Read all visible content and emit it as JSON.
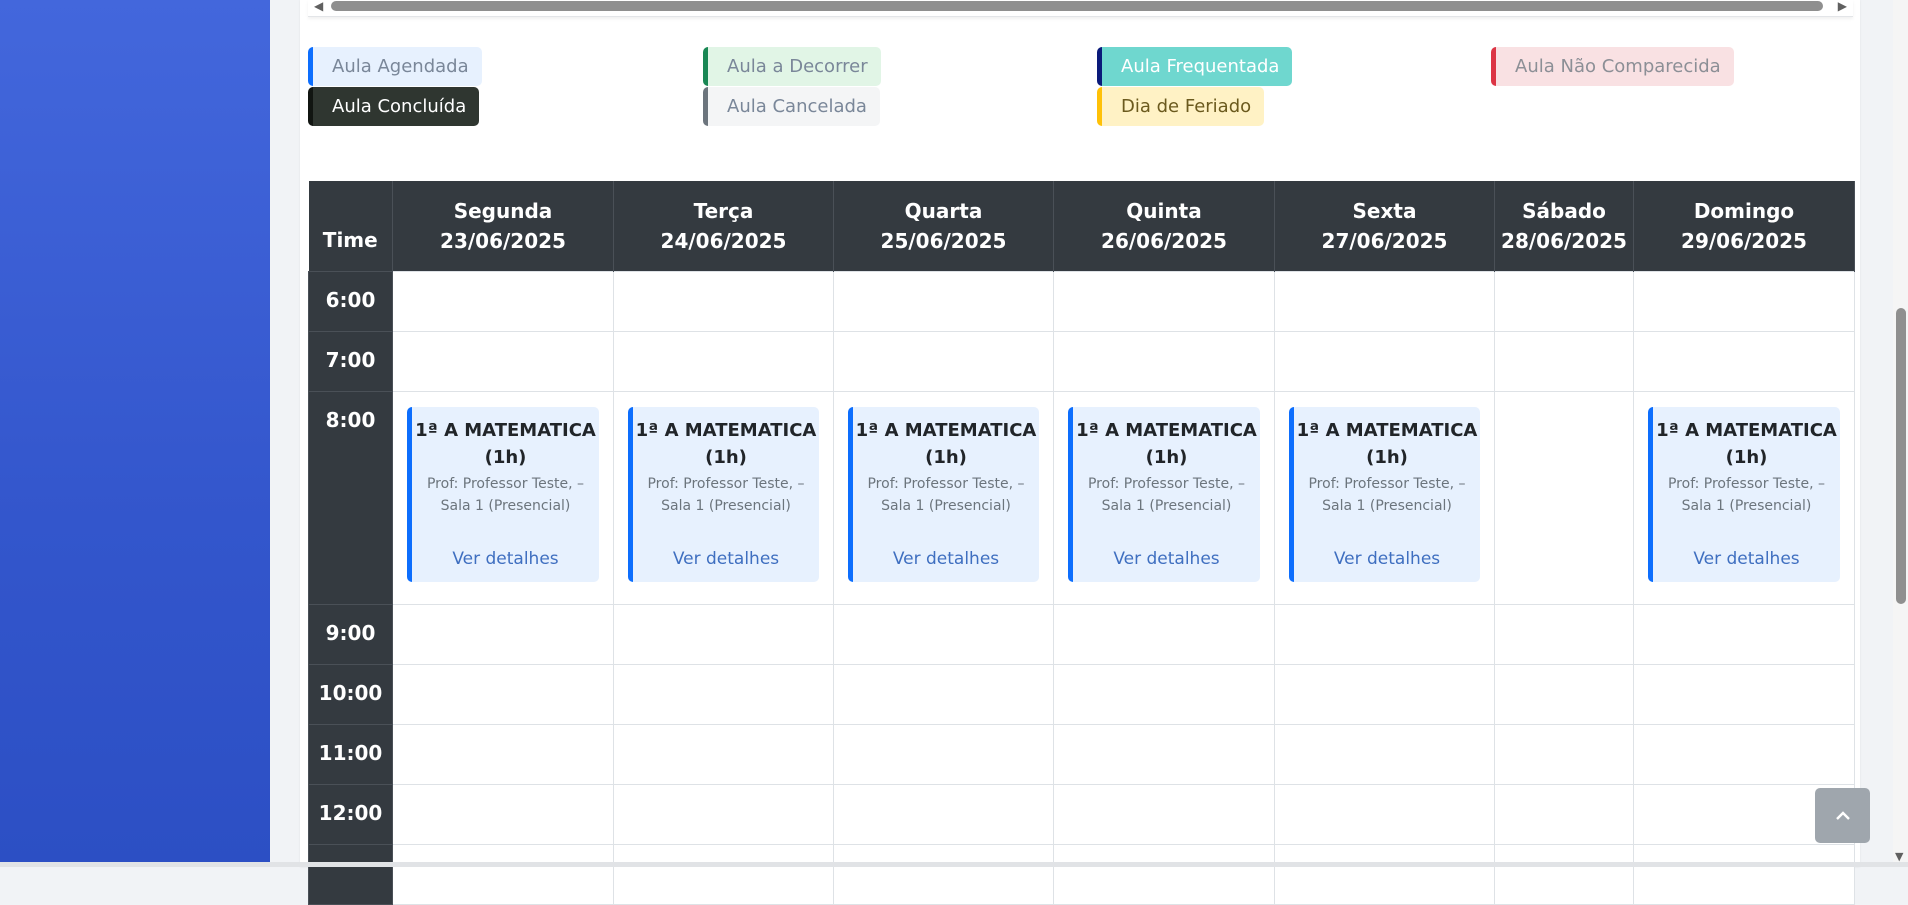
{
  "legend": [
    {
      "label": "Aula Agendada",
      "bg": "#e7f1fe",
      "border": "#0d6efd",
      "color": "#7a8799"
    },
    {
      "label": "Aula a Decorrer",
      "bg": "#e1f5e6",
      "border": "#198754",
      "color": "#7a8799"
    },
    {
      "label": "Aula Frequentada",
      "bg": "#6fd7cf",
      "border": "#0a1a7a",
      "color": "#ffffff"
    },
    {
      "label": "Aula Não Comparecida",
      "bg": "#f9e1e3",
      "border": "#dc3545",
      "color": "#8c8f96"
    },
    {
      "label": "Aula Concluída",
      "bg": "#2f3630",
      "border": "#111511",
      "color": "#ffffff"
    },
    {
      "label": "Aula Cancelada",
      "bg": "#f4f5f6",
      "border": "#6c757d",
      "color": "#7a8799"
    },
    {
      "label": "Dia de Feriado",
      "bg": "#fff2c5",
      "border": "#ffc107",
      "color": "#6b5a1e"
    }
  ],
  "table": {
    "time_header": "Time",
    "days": [
      {
        "name": "Segunda",
        "date": "23/06/2025"
      },
      {
        "name": "Terça",
        "date": "24/06/2025"
      },
      {
        "name": "Quarta",
        "date": "25/06/2025"
      },
      {
        "name": "Quinta",
        "date": "26/06/2025"
      },
      {
        "name": "Sexta",
        "date": "27/06/2025"
      },
      {
        "name": "Sábado",
        "date": "28/06/2025"
      },
      {
        "name": "Domingo",
        "date": "29/06/2025"
      }
    ],
    "times": [
      "6:00",
      "7:00",
      "8:00",
      "9:00",
      "10:00",
      "11:00",
      "12:00"
    ],
    "event": {
      "title": "1ª A MATEMATICA",
      "duration": "(1h)",
      "info_line1": "Prof: Professor Teste, –",
      "info_line2": "Sala 1 (Presencial)",
      "link": "Ver detalhes"
    }
  },
  "back_to_top_icon": "chevron-up-icon"
}
